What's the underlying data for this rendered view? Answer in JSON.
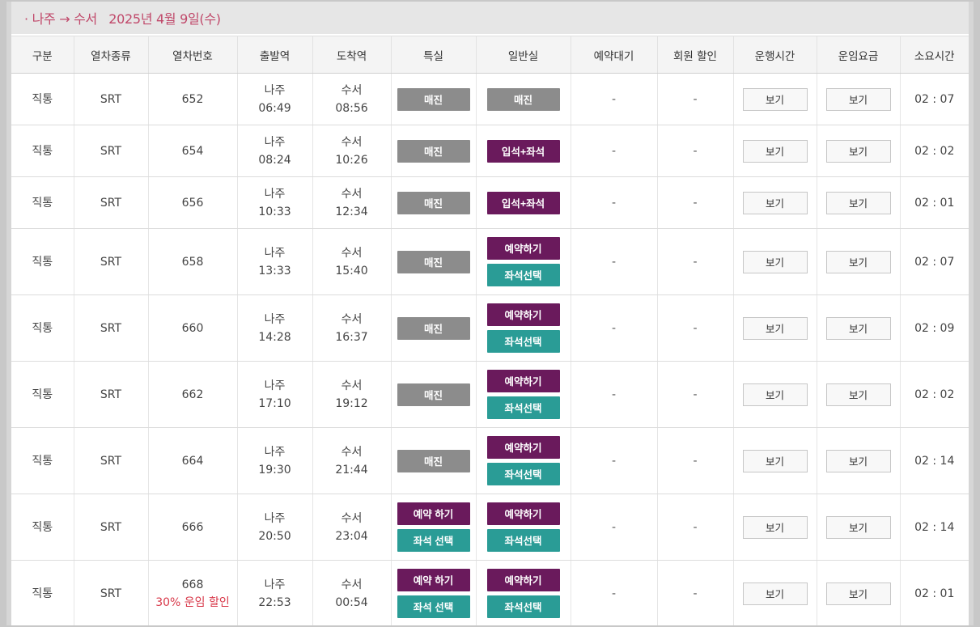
{
  "header": {
    "route": "· 나주 → 수서",
    "date": "2025년 4월 9일(수)"
  },
  "columns": [
    "구분",
    "열차종류",
    "열차번호",
    "출발역",
    "도착역",
    "특실",
    "일반실",
    "예약대기",
    "회원 할인",
    "운행시간",
    "운임요금",
    "소요시간"
  ],
  "colors": {
    "sold_out": "#8c8c8c",
    "reserve": "#6a1a5c",
    "seat_select": "#2a9c96",
    "discount_text": "#d8394a",
    "route_text": "#c0486a"
  },
  "rows": [
    {
      "type": "직통",
      "kind": "SRT",
      "number": "652",
      "discount": "",
      "dep_station": "나주",
      "dep_time": "06:49",
      "arr_station": "수서",
      "arr_time": "08:56",
      "special": [
        "매진"
      ],
      "general": [
        "매진"
      ],
      "waitlist": "-",
      "member_discount": "-",
      "schedule": "보기",
      "fare": "보기",
      "duration": "02 : 07"
    },
    {
      "type": "직통",
      "kind": "SRT",
      "number": "654",
      "discount": "",
      "dep_station": "나주",
      "dep_time": "08:24",
      "arr_station": "수서",
      "arr_time": "10:26",
      "special": [
        "매진"
      ],
      "general": [
        "입석+좌석"
      ],
      "waitlist": "-",
      "member_discount": "-",
      "schedule": "보기",
      "fare": "보기",
      "duration": "02 : 02"
    },
    {
      "type": "직통",
      "kind": "SRT",
      "number": "656",
      "discount": "",
      "dep_station": "나주",
      "dep_time": "10:33",
      "arr_station": "수서",
      "arr_time": "12:34",
      "special": [
        "매진"
      ],
      "general": [
        "입석+좌석"
      ],
      "waitlist": "-",
      "member_discount": "-",
      "schedule": "보기",
      "fare": "보기",
      "duration": "02 : 01"
    },
    {
      "type": "직통",
      "kind": "SRT",
      "number": "658",
      "discount": "",
      "dep_station": "나주",
      "dep_time": "13:33",
      "arr_station": "수서",
      "arr_time": "15:40",
      "special": [
        "매진"
      ],
      "general": [
        "예약하기",
        "좌석선택"
      ],
      "waitlist": "-",
      "member_discount": "-",
      "schedule": "보기",
      "fare": "보기",
      "duration": "02 : 07"
    },
    {
      "type": "직통",
      "kind": "SRT",
      "number": "660",
      "discount": "",
      "dep_station": "나주",
      "dep_time": "14:28",
      "arr_station": "수서",
      "arr_time": "16:37",
      "special": [
        "매진"
      ],
      "general": [
        "예약하기",
        "좌석선택"
      ],
      "waitlist": "-",
      "member_discount": "-",
      "schedule": "보기",
      "fare": "보기",
      "duration": "02 : 09"
    },
    {
      "type": "직통",
      "kind": "SRT",
      "number": "662",
      "discount": "",
      "dep_station": "나주",
      "dep_time": "17:10",
      "arr_station": "수서",
      "arr_time": "19:12",
      "special": [
        "매진"
      ],
      "general": [
        "예약하기",
        "좌석선택"
      ],
      "waitlist": "-",
      "member_discount": "-",
      "schedule": "보기",
      "fare": "보기",
      "duration": "02 : 02"
    },
    {
      "type": "직통",
      "kind": "SRT",
      "number": "664",
      "discount": "",
      "dep_station": "나주",
      "dep_time": "19:30",
      "arr_station": "수서",
      "arr_time": "21:44",
      "special": [
        "매진"
      ],
      "general": [
        "예약하기",
        "좌석선택"
      ],
      "waitlist": "-",
      "member_discount": "-",
      "schedule": "보기",
      "fare": "보기",
      "duration": "02 : 14"
    },
    {
      "type": "직통",
      "kind": "SRT",
      "number": "666",
      "discount": "",
      "dep_station": "나주",
      "dep_time": "20:50",
      "arr_station": "수서",
      "arr_time": "23:04",
      "special": [
        "예약 하기",
        "좌석 선택"
      ],
      "general": [
        "예약하기",
        "좌석선택"
      ],
      "waitlist": "-",
      "member_discount": "-",
      "schedule": "보기",
      "fare": "보기",
      "duration": "02 : 14"
    },
    {
      "type": "직통",
      "kind": "SRT",
      "number": "668",
      "discount": "30% 운임 할인",
      "dep_station": "나주",
      "dep_time": "22:53",
      "arr_station": "수서",
      "arr_time": "00:54",
      "special": [
        "예약 하기",
        "좌석 선택"
      ],
      "general": [
        "예약하기",
        "좌석선택"
      ],
      "waitlist": "-",
      "member_discount": "-",
      "schedule": "보기",
      "fare": "보기",
      "duration": "02 : 01"
    }
  ]
}
